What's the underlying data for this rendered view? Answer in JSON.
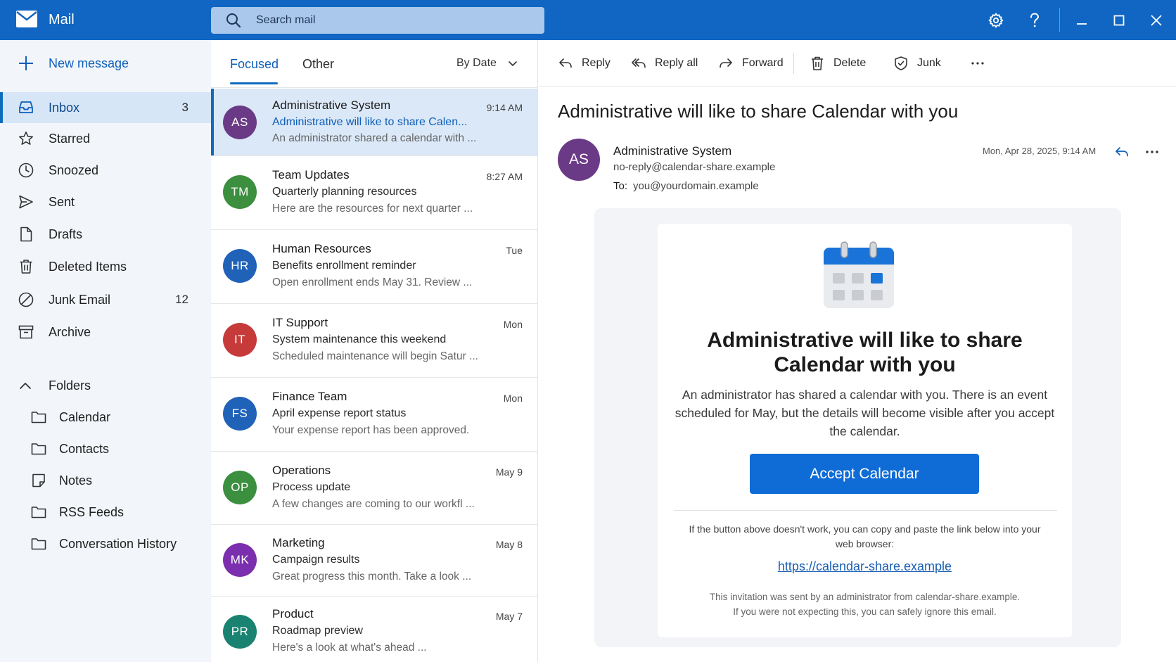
{
  "app": {
    "name": "Mail"
  },
  "colors": {
    "titlebar": "#1066c2",
    "accent": "#0f6cbd",
    "primary_button": "#0f6cd6"
  },
  "search": {
    "placeholder": "Search mail",
    "value": ""
  },
  "titlebar_icons": [
    "gear-icon",
    "help-icon",
    "minimize-icon",
    "maximize-icon",
    "close-icon"
  ],
  "nav": {
    "new_message": "New message",
    "items": [
      {
        "label": "Inbox",
        "count": "3",
        "icon": "inbox-icon"
      },
      {
        "label": "Starred",
        "count": "",
        "icon": "star-icon"
      },
      {
        "label": "Snoozed",
        "count": "",
        "icon": "clock-icon"
      },
      {
        "label": "Sent",
        "count": "",
        "icon": "send-icon"
      },
      {
        "label": "Drafts",
        "count": "",
        "icon": "draft-icon"
      },
      {
        "label": "Deleted Items",
        "count": "",
        "icon": "trash-icon"
      },
      {
        "label": "Junk Email",
        "count": "12",
        "icon": "junk-icon"
      },
      {
        "label": "Archive",
        "count": "",
        "icon": "archive-icon"
      }
    ],
    "folders_label": "Folders",
    "folders": [
      {
        "label": "Calendar",
        "icon": "folder-icon"
      },
      {
        "label": "Contacts",
        "icon": "folder-icon"
      },
      {
        "label": "Notes",
        "icon": "note-icon"
      },
      {
        "label": "RSS Feeds",
        "icon": "folder-icon"
      },
      {
        "label": "Conversation History",
        "icon": "folder-icon"
      }
    ]
  },
  "list": {
    "tabs": [
      "Focused",
      "Other"
    ],
    "active_tab": "Focused",
    "sort_label": "By Date",
    "messages": [
      {
        "initials": "AS",
        "color": "#6b3a86",
        "sender": "Administrative System",
        "time": "9:14 AM",
        "subject": "Administrative will like to share Calen...",
        "preview": "An administrator shared a calendar with ...",
        "selected": true
      },
      {
        "initials": "TM",
        "color": "#3b8f3f",
        "sender": "Team Updates",
        "time": "8:27 AM",
        "subject": "Quarterly planning resources",
        "preview": "Here are the resources for next quarter ...",
        "selected": false
      },
      {
        "initials": "HR",
        "color": "#1f62b8",
        "sender": "Human Resources",
        "time": "Tue",
        "subject": "Benefits enrollment reminder",
        "preview": "Open enrollment ends May 31. Review ...",
        "selected": false
      },
      {
        "initials": "IT",
        "color": "#c63a3a",
        "sender": "IT Support",
        "time": "Mon",
        "subject": "System maintenance this weekend",
        "preview": "Scheduled maintenance will begin Satur ...",
        "selected": false
      },
      {
        "initials": "FS",
        "color": "#1f62b8",
        "sender": "Finance Team",
        "time": "Mon",
        "subject": "April expense report status",
        "preview": "Your expense report has been approved.",
        "selected": false
      },
      {
        "initials": "OP",
        "color": "#3b8f3f",
        "sender": "Operations",
        "time": "May 9",
        "subject": "Process update",
        "preview": "A few changes are coming to our workfl ...",
        "selected": false
      },
      {
        "initials": "MK",
        "color": "#7b2fae",
        "sender": "Marketing",
        "time": "May 8",
        "subject": "Campaign results",
        "preview": "Great progress this month. Take a look ...",
        "selected": false
      },
      {
        "initials": "PR",
        "color": "#1a8270",
        "sender": "Product",
        "time": "May 7",
        "subject": "Roadmap preview",
        "preview": "Here's a look at what's ahead ...",
        "selected": false
      }
    ]
  },
  "toolbar": {
    "reply": "Reply",
    "reply_all": "Reply all",
    "forward": "Forward",
    "delete": "Delete",
    "junk": "Junk",
    "more": "···"
  },
  "email": {
    "subject": "Administrative will like to share Calendar with you",
    "sender_initials": "AS",
    "sender_name": "Administrative System",
    "sender_email": "no-reply@calendar-share.example",
    "to_label": "To:",
    "to": "you@yourdomain.example",
    "date": "Mon, Apr 28, 2025, 9:14 AM",
    "card": {
      "title": "Administrative will like to share Calendar with you",
      "body": "An administrator has shared a calendar with you. There is an event scheduled for May, but the details will become visible after you accept the calendar.",
      "button": "Accept Calendar",
      "fallback": "If the button above doesn't work, you can copy and paste the link below into your web browser:",
      "link": "https://calendar-share.example",
      "footer_line1": "This invitation was sent by an administrator from calendar-share.example.",
      "footer_line2": "If you were not expecting this, you can safely ignore this email."
    }
  }
}
